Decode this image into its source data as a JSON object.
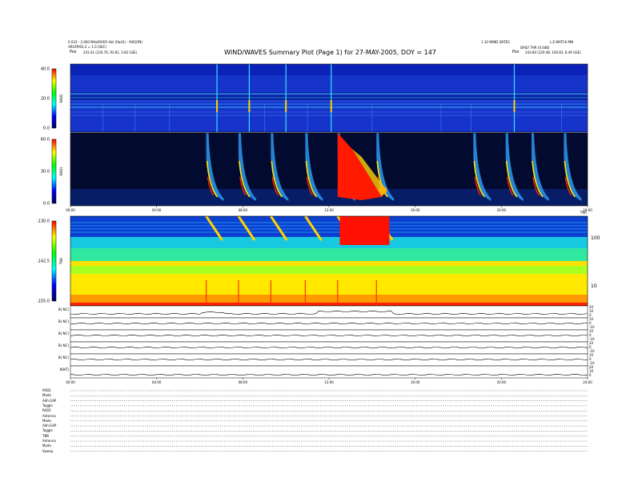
{
  "header": {
    "left_line1": "0.033 - 2.000 MHz(RAD1-Hz) (Rad1) - AVE(ON)",
    "left_line2": "ARGFPI03.2 = 1.0 (SEC)",
    "left_pos_label": "Pos",
    "left_pos_value": "243.41 (220.76, 93.81, 3.82 GSE)",
    "title": "WIND/WAVES Summary Plot (Page 1) for 27-MAY-2005, DOY = 147",
    "right_line1_a": "1.10 WIND DATES",
    "right_line1_b": "L.E.WATCH MN",
    "right_line2": "DAILY THR (0.0dB)",
    "right_pos_label": "Pos",
    "right_pos_value": "243.80 (220.48, 100.83, 8.49 GSE)",
    "panel_corner": "TNR"
  },
  "chart_data": [
    {
      "type": "heatmap",
      "panel": "RAD2",
      "ylabel": "RAD2",
      "colorbar_ticks": [
        "40.0",
        "20.0",
        "0.0"
      ],
      "bursts_hours": [
        6.8,
        8.3,
        10.0,
        12.1,
        20.6
      ]
    },
    {
      "type": "heatmap",
      "panel": "RAD1",
      "ylabel": "RAD1",
      "colorbar_ticks": [
        "60.0",
        "30.0",
        "0.0"
      ],
      "x_ticks": [
        "00:00",
        "04:00",
        "08:00",
        "12:00",
        "16:00",
        "20:00",
        "24:00"
      ],
      "bursts_hours": [
        6.3,
        7.8,
        9.3,
        10.9,
        12.4,
        14.2,
        18.7,
        20.2,
        21.4,
        22.9
      ]
    },
    {
      "type": "heatmap",
      "panel": "TNR",
      "ylabel": "TNR",
      "colorbar_ticks": [
        "-130.0",
        "-142.5",
        "-155.0"
      ],
      "right_ticks": [
        "100",
        "10"
      ],
      "x_ticks": [
        "00:00",
        "04:00",
        "08:00",
        "12:00",
        "16:00",
        "20:00",
        "24:00"
      ]
    },
    {
      "type": "line",
      "panels": [
        {
          "label": "B(-NC)",
          "right_ticks": [
            "20",
            "10",
            "0"
          ]
        },
        {
          "label": "B(-NC)",
          "right_ticks": [
            "10",
            "0",
            "-10"
          ]
        },
        {
          "label": "B(-NC)",
          "right_ticks": [
            "10",
            "0",
            "-10"
          ]
        },
        {
          "label": "B(-NC)",
          "right_ticks": [
            "10",
            "0",
            "-10"
          ]
        },
        {
          "label": "B(-NC)",
          "right_ticks": [
            "10",
            "0",
            "-10"
          ]
        },
        {
          "label": "B(NT)",
          "right_ticks": [
            "20",
            "10",
            "0"
          ]
        }
      ],
      "x_ticks": [
        "00:00",
        "04:00",
        "08:00",
        "12:00",
        "16:00",
        "20:00",
        "24:00"
      ],
      "xlim": [
        0,
        24
      ]
    }
  ],
  "status_rows": [
    "RAD1",
    "Mode",
    "Adh:GAP",
    "Toggle",
    "RAD1",
    "Antenna",
    "Mode",
    "Adh:GAP",
    "Toggle",
    "TNR",
    "Antenna",
    "Mode",
    "Sweep"
  ]
}
